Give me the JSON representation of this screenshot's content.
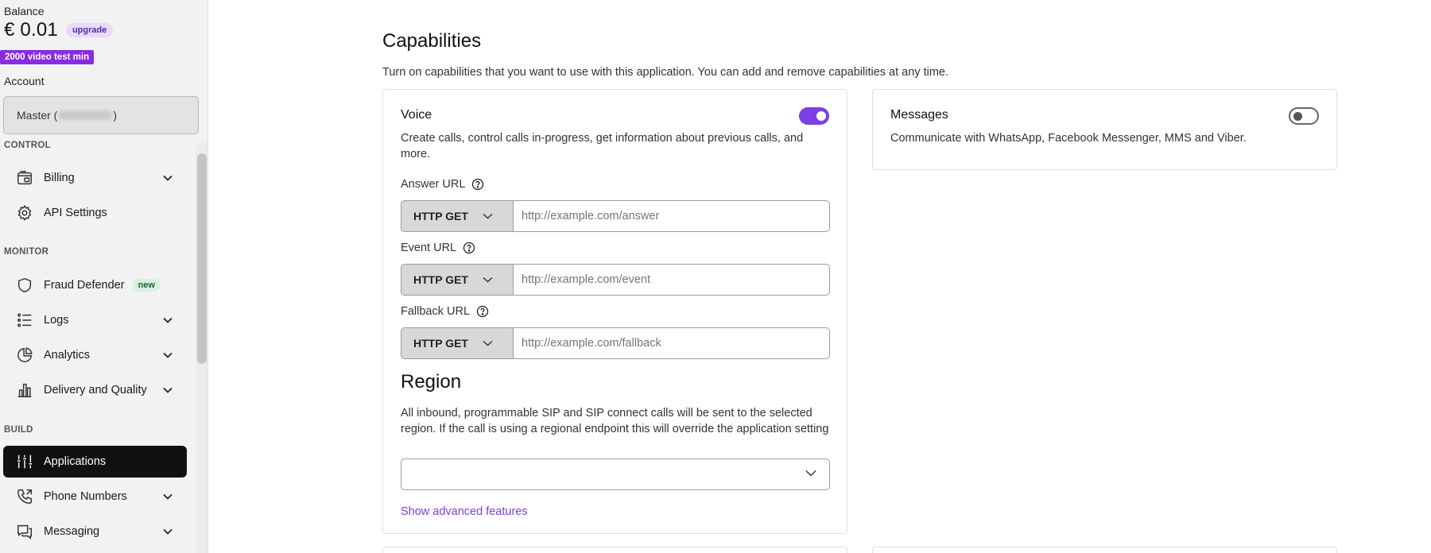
{
  "sidebar": {
    "balance_label": "Balance",
    "balance_amount": "€ 0.01",
    "upgrade_label": "upgrade",
    "video_badge": "2000 video test min",
    "account_label": "Account",
    "account_prefix": "Master (",
    "account_suffix": ")",
    "sections": {
      "control": "CONTROL",
      "monitor": "MONITOR",
      "build": "BUILD"
    },
    "items": [
      {
        "label": "Billing",
        "icon": "billing-icon",
        "chevron": true
      },
      {
        "label": "API Settings",
        "icon": "gear-icon",
        "chevron": false
      },
      {
        "label": "Fraud Defender",
        "icon": "shield-icon",
        "badge": "new"
      },
      {
        "label": "Logs",
        "icon": "list-icon",
        "chevron": true
      },
      {
        "label": "Analytics",
        "icon": "pie-chart-icon",
        "chevron": true
      },
      {
        "label": "Delivery and Quality",
        "icon": "bar-chart-icon",
        "chevron": true
      },
      {
        "label": "Applications",
        "icon": "applications-icon",
        "active": true
      },
      {
        "label": "Phone Numbers",
        "icon": "phone-icon",
        "chevron": true
      },
      {
        "label": "Messaging",
        "icon": "chat-icon",
        "chevron": true
      }
    ]
  },
  "main": {
    "title": "Capabilities",
    "subtitle": "Turn on capabilities that you want to use with this application. You can add and remove capabilities at any time.",
    "voice": {
      "title": "Voice",
      "enabled": true,
      "description": "Create calls, control calls in-progress, get information about previous calls, and more.",
      "answer_url": {
        "label": "Answer URL",
        "method": "HTTP GET",
        "placeholder": "http://example.com/answer"
      },
      "event_url": {
        "label": "Event URL",
        "method": "HTTP GET",
        "placeholder": "http://example.com/event"
      },
      "fallback_url": {
        "label": "Fallback URL",
        "method": "HTTP GET",
        "placeholder": "http://example.com/fallback"
      },
      "region_title": "Region",
      "region_description": "All inbound, programmable SIP and SIP connect calls will be sent to the selected region. If the call is using a regional endpoint this will override the application setting",
      "region_value": "",
      "advanced_link": "Show advanced features"
    },
    "messages": {
      "title": "Messages",
      "enabled": false,
      "description": "Communicate with WhatsApp, Facebook Messenger, MMS and Viber."
    }
  },
  "colors": {
    "accent": "#7b3fe4",
    "video_badge": "#8a2be2",
    "active_nav": "#111111",
    "new_badge_bg": "#d6f0dd"
  }
}
